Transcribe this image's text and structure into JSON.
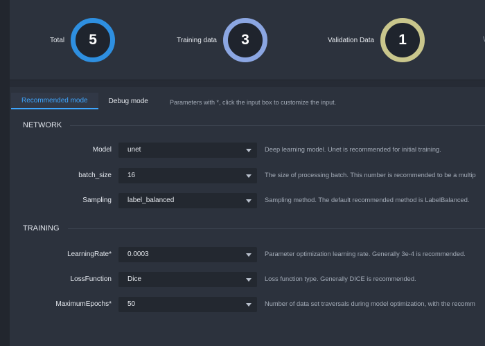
{
  "summary": {
    "stats": [
      {
        "label": "Total",
        "value": "5",
        "ring_color": "#2e8fe0"
      },
      {
        "label": "Training data",
        "value": "3",
        "ring_color": "#8ba6e2"
      },
      {
        "label": "Validation Data",
        "value": "1",
        "ring_color": "#c9c68c"
      }
    ],
    "edge_glyph": "\\"
  },
  "tabs": {
    "recommended": "Recommended mode",
    "debug": "Debug mode",
    "hint": "Parameters with *, click the input box to customize the input."
  },
  "network": {
    "title": "NETWORK",
    "rows": [
      {
        "label": "Model",
        "value": "unet",
        "desc": "Deep learning model. Unet is recommended for initial training."
      },
      {
        "label": "batch_size",
        "value": "16",
        "desc": "The size of processing batch. This number is recommended to be a multip"
      },
      {
        "label": "Sampling",
        "value": "label_balanced",
        "desc": "Sampling method. The default recommended method is LabelBalanced."
      }
    ]
  },
  "training": {
    "title": "TRAINING",
    "rows": [
      {
        "label": "LearningRate*",
        "value": "0.0003",
        "desc": "Parameter optimization learning rate. Generally 3e-4 is recommended."
      },
      {
        "label": "LossFunction",
        "value": "Dice",
        "desc": "Loss function type. Generally DICE is recommended."
      },
      {
        "label": "MaximumEpochs*",
        "value": "50",
        "desc": "Number of data set traversals during model optimization, with the recomm"
      }
    ]
  }
}
